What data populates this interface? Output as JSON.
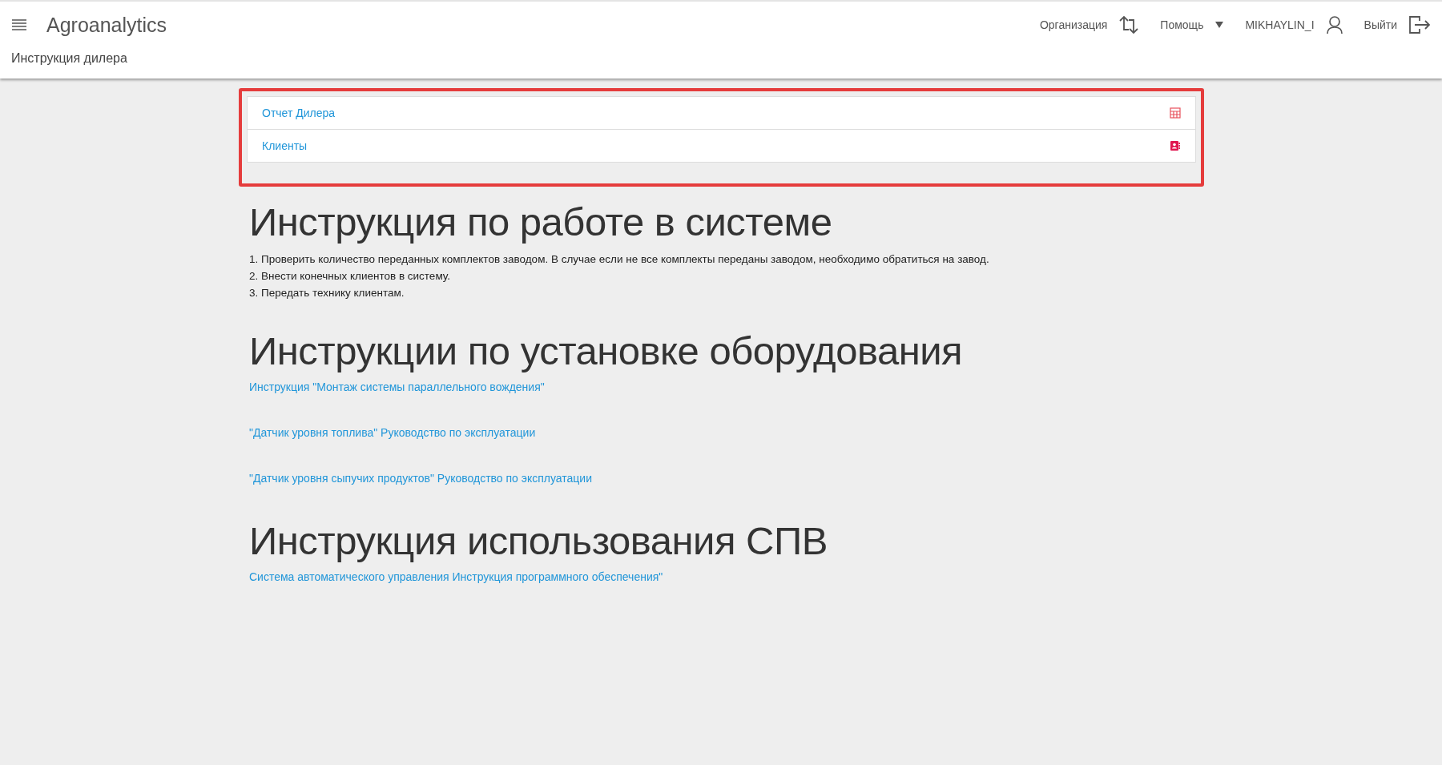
{
  "header": {
    "app_title": "Agroanalytics",
    "breadcrumb": "Инструкция дилера",
    "nav": [
      {
        "kind": "org",
        "label": "Организация"
      },
      {
        "kind": "help",
        "label": "Помощь"
      },
      {
        "kind": "user",
        "label": "MIKHAYLIN_I"
      },
      {
        "kind": "logout",
        "label": "Выйти"
      }
    ]
  },
  "panel": {
    "items": [
      {
        "label": "Отчет Дилера",
        "kind": "table"
      },
      {
        "label": "Клиенты",
        "kind": "contacts"
      }
    ]
  },
  "sections": [
    {
      "kind": "steps",
      "title": "Инструкция по работе в системе",
      "items": [
        "1. Проверить количество переданных комплектов заводом. В случае если не все комплекты переданы заводом, необходимо обратиться на завод.",
        "2. Внести конечных клиентов в систему.",
        "3. Передать технику клиентам."
      ]
    },
    {
      "kind": "links",
      "title": "Инструкции по установке оборудования",
      "items": [
        "Инструкция \"Монтаж системы параллельного вождения\"",
        "\"Датчик уровня топлива\" Руководство по эксплуатации",
        "\"Датчик уровня сыпучих продуктов\" Руководство по эксплуатации"
      ]
    },
    {
      "kind": "links",
      "title": "Инструкция использования СПВ",
      "items": [
        "Система автоматического управления Инструкция программного обеспечения\""
      ]
    }
  ]
}
